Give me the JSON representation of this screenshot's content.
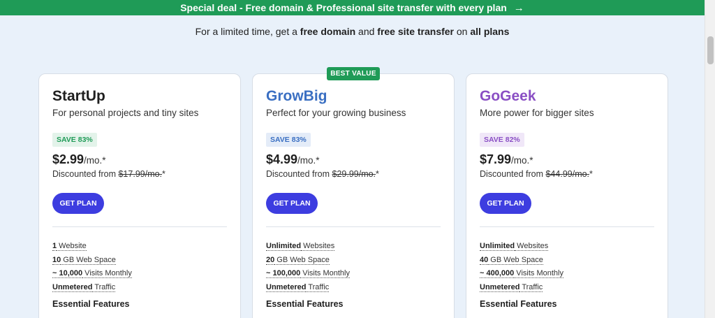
{
  "banner": {
    "text": "Special deal - Free domain & Professional site transfer with every plan",
    "arrow": "→"
  },
  "subtitle": {
    "p1": "For a limited time, get a ",
    "b1": "free domain",
    "p2": " and ",
    "b2": "free site transfer",
    "p3": " on ",
    "b3": "all plans"
  },
  "best_value": "BEST VALUE",
  "colors": {
    "green": "#1f9b57",
    "blue": "#3a6fc2",
    "purple": "#8a4fc4",
    "button": "#3d3de0"
  },
  "plans": [
    {
      "name": "StartUp",
      "desc": "For personal projects and tiny sites",
      "save": "SAVE 83%",
      "price": "$2.99",
      "per": "/mo.*",
      "discount_prefix": "Discounted from ",
      "old_price": "$17.99/mo.",
      "discount_suffix": "*",
      "cta": "GET PLAN",
      "features": [
        {
          "bold": "1",
          "rest": " Website"
        },
        {
          "bold": "10",
          "rest": " GB Web Space"
        },
        {
          "bold": "~ 10,000",
          "rest": " Visits Monthly"
        },
        {
          "bold": "Unmetered",
          "rest": " Traffic"
        }
      ],
      "essential": "Essential Features"
    },
    {
      "name": "GrowBig",
      "desc": "Perfect for your growing business",
      "save": "SAVE 83%",
      "price": "$4.99",
      "per": "/mo.*",
      "discount_prefix": "Discounted from ",
      "old_price": "$29.99/mo.",
      "discount_suffix": "*",
      "cta": "GET PLAN",
      "features": [
        {
          "bold": "Unlimited",
          "rest": " Websites"
        },
        {
          "bold": "20",
          "rest": " GB Web Space"
        },
        {
          "bold": "~ 100,000",
          "rest": " Visits Monthly"
        },
        {
          "bold": "Unmetered",
          "rest": " Traffic"
        }
      ],
      "essential": "Essential Features"
    },
    {
      "name": "GoGeek",
      "desc": "More power for bigger sites",
      "save": "SAVE 82%",
      "price": "$7.99",
      "per": "/mo.*",
      "discount_prefix": "Discounted from ",
      "old_price": "$44.99/mo.",
      "discount_suffix": "*",
      "cta": "GET PLAN",
      "features": [
        {
          "bold": "Unlimited",
          "rest": " Websites"
        },
        {
          "bold": "40",
          "rest": " GB Web Space"
        },
        {
          "bold": "~ 400,000",
          "rest": " Visits Monthly"
        },
        {
          "bold": "Unmetered",
          "rest": " Traffic"
        }
      ],
      "essential": "Essential Features"
    }
  ]
}
